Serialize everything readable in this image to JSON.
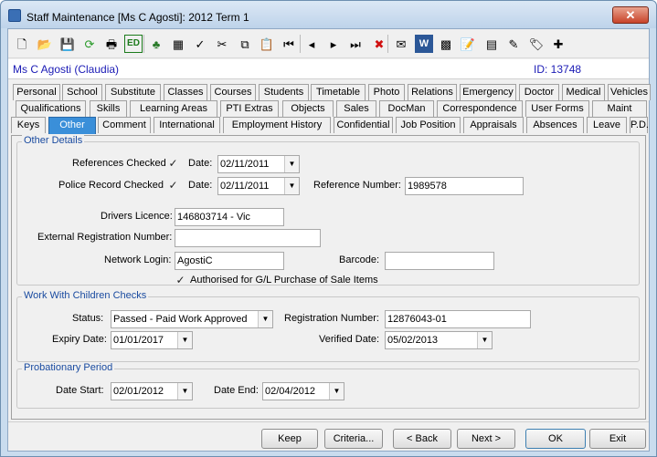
{
  "window": {
    "title": "Staff Maintenance  [Ms C Agosti]:  2012 Term 1",
    "close_glyph": "✕"
  },
  "toolbar": {
    "icons": [
      "new-icon",
      "open-folder-icon",
      "save-icon",
      "refresh-icon",
      "print-icon",
      "edit-icon",
      "tree-icon",
      "calculator-icon",
      "spellcheck-icon",
      "cut-icon",
      "copy-icon",
      "paste-icon",
      "first-record-icon",
      "previous-record-icon",
      "next-record-icon",
      "last-record-icon",
      "delete-icon",
      "email-icon",
      "word-icon",
      "excel-icon",
      "clipboard-icon",
      "calendar-icon",
      "pen-icon",
      "tag-icon",
      "document-add-icon"
    ],
    "edit_text": "ED",
    "glyphs": [
      "🗋",
      "📂",
      "💾",
      "⟳",
      "🖶",
      "",
      "♣",
      "▦",
      "✓",
      "✂",
      "⧉",
      "📋",
      "⏮",
      "◂",
      "▸",
      "⏭",
      "✖",
      "✉",
      "W",
      "▩",
      "📝",
      "▤",
      "✎",
      "🏷",
      "✚"
    ]
  },
  "person": {
    "name": "Ms C Agosti (Claudia)",
    "id_label": "ID: 13748"
  },
  "tabs": {
    "row1": [
      "Personal",
      "School",
      "Substitute",
      "Classes",
      "Courses",
      "Students",
      "Timetable",
      "Photo",
      "Relations",
      "Emergency",
      "Doctor",
      "Medical",
      "Vehicles"
    ],
    "row2": [
      "Qualifications",
      "Skills",
      "Learning Areas",
      "PTI Extras",
      "Objects",
      "Sales",
      "DocMan",
      "Correspondence",
      "User Forms",
      "Maint"
    ],
    "row3": [
      "Keys",
      "Other",
      "Comment",
      "International",
      "Employment History",
      "Confidential",
      "Job Position",
      "Appraisals",
      "Absences",
      "Leave",
      "P.D."
    ]
  },
  "other_details": {
    "legend": "Other Details",
    "references_checked_label": "References Checked",
    "references_checked": true,
    "ref_date_label": "Date:",
    "ref_date": "02/11/2011",
    "police_label": "Police Record Checked",
    "police_checked": true,
    "police_date_label": "Date:",
    "police_date": "02/11/2011",
    "reference_number_label": "Reference Number:",
    "reference_number": "1989578",
    "drivers_licence_label": "Drivers Licence:",
    "drivers_licence": "146803714 - Vic",
    "external_reg_label": "External Registration Number:",
    "external_reg": "",
    "network_login_label": "Network Login:",
    "network_login": "AgostiC",
    "barcode_label": "Barcode:",
    "barcode": "",
    "authorised_label": "Authorised for G/L Purchase of Sale Items",
    "authorised_checked": true
  },
  "wwc": {
    "legend": "Work With Children Checks",
    "status_label": "Status:",
    "status": "Passed - Paid Work Approved",
    "registration_label": "Registration Number:",
    "registration": "12876043-01",
    "expiry_label": "Expiry Date:",
    "expiry": "01/01/2017",
    "verified_label": "Verified Date:",
    "verified": "05/02/2013"
  },
  "probation": {
    "legend": "Probationary Period",
    "start_label": "Date Start:",
    "start": "02/01/2012",
    "end_label": "Date End:",
    "end": "02/04/2012"
  },
  "buttons": {
    "keep": "Keep",
    "criteria": "Criteria...",
    "back": "< Back",
    "next": "Next >",
    "ok": "OK",
    "exit": "Exit"
  },
  "glyphs": {
    "check": "✓",
    "dropdown": "▼"
  },
  "colors": {
    "accent_blue": "#1a1ab5",
    "active_tab": "#3a8fd9",
    "legend": "#1a4ba0"
  }
}
